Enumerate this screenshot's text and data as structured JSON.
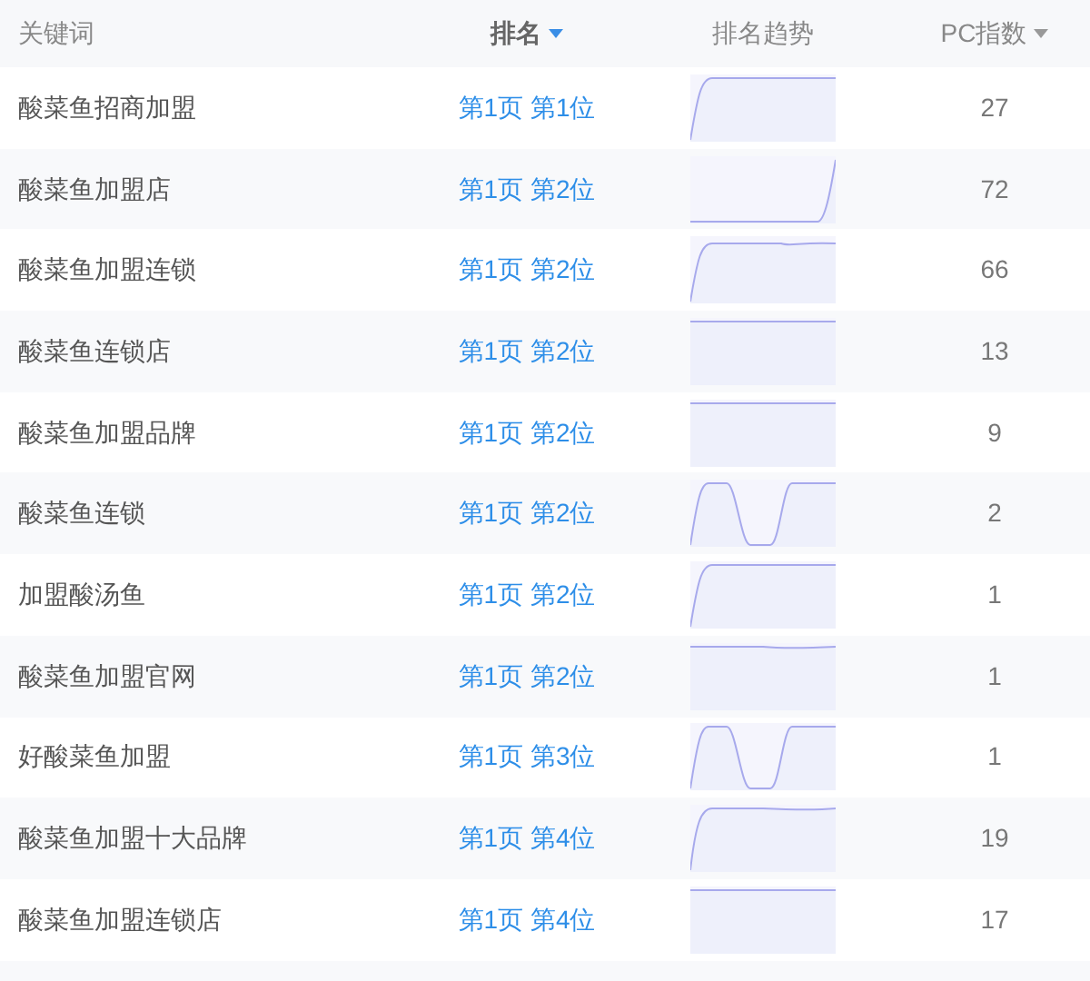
{
  "columns": [
    {
      "label": "关键词",
      "sortable": false,
      "sorted": false
    },
    {
      "label": "排名",
      "sortable": true,
      "sorted": true
    },
    {
      "label": "排名趋势",
      "sortable": false,
      "sorted": false
    },
    {
      "label": "PC指数",
      "sortable": true,
      "sorted": false
    }
  ],
  "rows": [
    {
      "keyword": "酸菜鱼招商加盟",
      "rank": "第1页 第1位",
      "pc_index": "27"
    },
    {
      "keyword": "酸菜鱼加盟店",
      "rank": "第1页 第2位",
      "pc_index": "72"
    },
    {
      "keyword": "酸菜鱼加盟连锁",
      "rank": "第1页 第2位",
      "pc_index": "66"
    },
    {
      "keyword": "酸菜鱼连锁店",
      "rank": "第1页 第2位",
      "pc_index": "13"
    },
    {
      "keyword": "酸菜鱼加盟品牌",
      "rank": "第1页 第2位",
      "pc_index": "9"
    },
    {
      "keyword": "酸菜鱼连锁",
      "rank": "第1页 第2位",
      "pc_index": "2"
    },
    {
      "keyword": "加盟酸汤鱼",
      "rank": "第1页 第2位",
      "pc_index": "1"
    },
    {
      "keyword": "酸菜鱼加盟官网",
      "rank": "第1页 第2位",
      "pc_index": "1"
    },
    {
      "keyword": "好酸菜鱼加盟",
      "rank": "第1页 第3位",
      "pc_index": "1"
    },
    {
      "keyword": "酸菜鱼加盟十大品牌",
      "rank": "第1页 第4位",
      "pc_index": "19"
    },
    {
      "keyword": "酸菜鱼加盟连锁店",
      "rank": "第1页 第4位",
      "pc_index": "17"
    }
  ]
}
